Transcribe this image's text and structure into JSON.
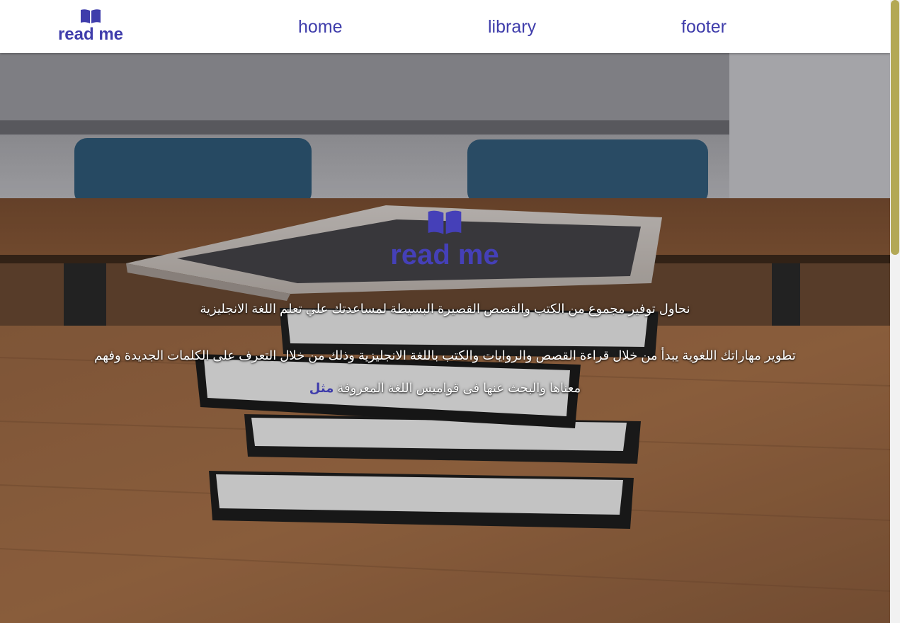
{
  "brand": {
    "name": "read me",
    "icon": "open-book-icon",
    "color": "#3f3dab"
  },
  "nav": {
    "items": [
      {
        "label": "home"
      },
      {
        "label": "library"
      },
      {
        "label": "footer"
      }
    ]
  },
  "hero": {
    "logo_text": "read me",
    "logo_icon": "open-book-icon",
    "line1": "نحاول توفير مجموع من الكتب والقصص القصيرة البسيطة لمساعدتك علي تعلم اللغة الانجليزية",
    "line2": "تطوير مهاراتك اللغوية يبدأ من خلال قراءة القصص والروايات والكتب باللغة الانجليزية وذلك من خلال التعرف على الكلمات الجديدة وفهم",
    "line3_text": "معناها والبحث عنها فى قواميس اللغة المعروفة ",
    "line3_link": "مثل",
    "background": "photo of a stack of books with a tablet on a wooden classroom desk"
  },
  "colors": {
    "accent": "#3f3dab",
    "scroll_thumb": "#b3a855"
  }
}
